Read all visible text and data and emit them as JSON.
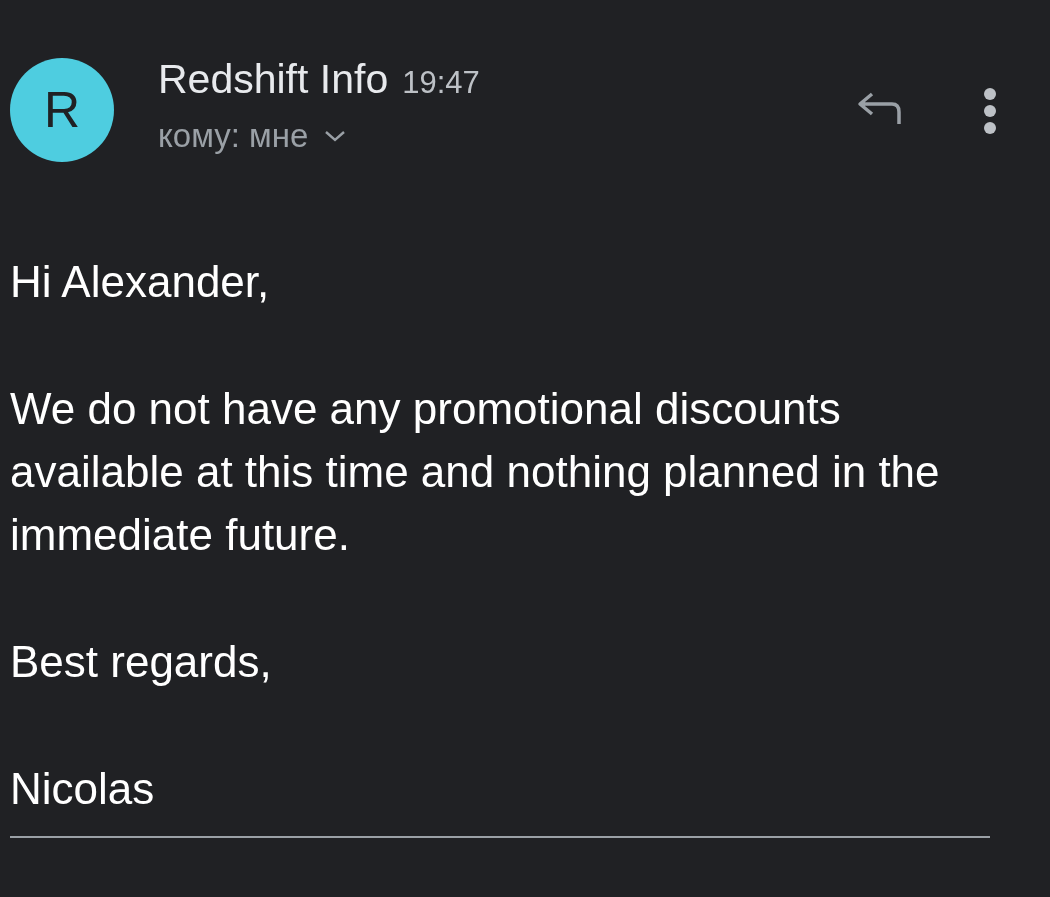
{
  "message": {
    "sender_initial": "R",
    "sender": "Redshift Info",
    "time": "19:47",
    "recipient": "кому: мне",
    "body": [
      "Hi Alexander,",
      "We do not have any promotional discounts available at this time and nothing planned in the immediate future.",
      "Best regards,",
      "Nicolas"
    ]
  }
}
